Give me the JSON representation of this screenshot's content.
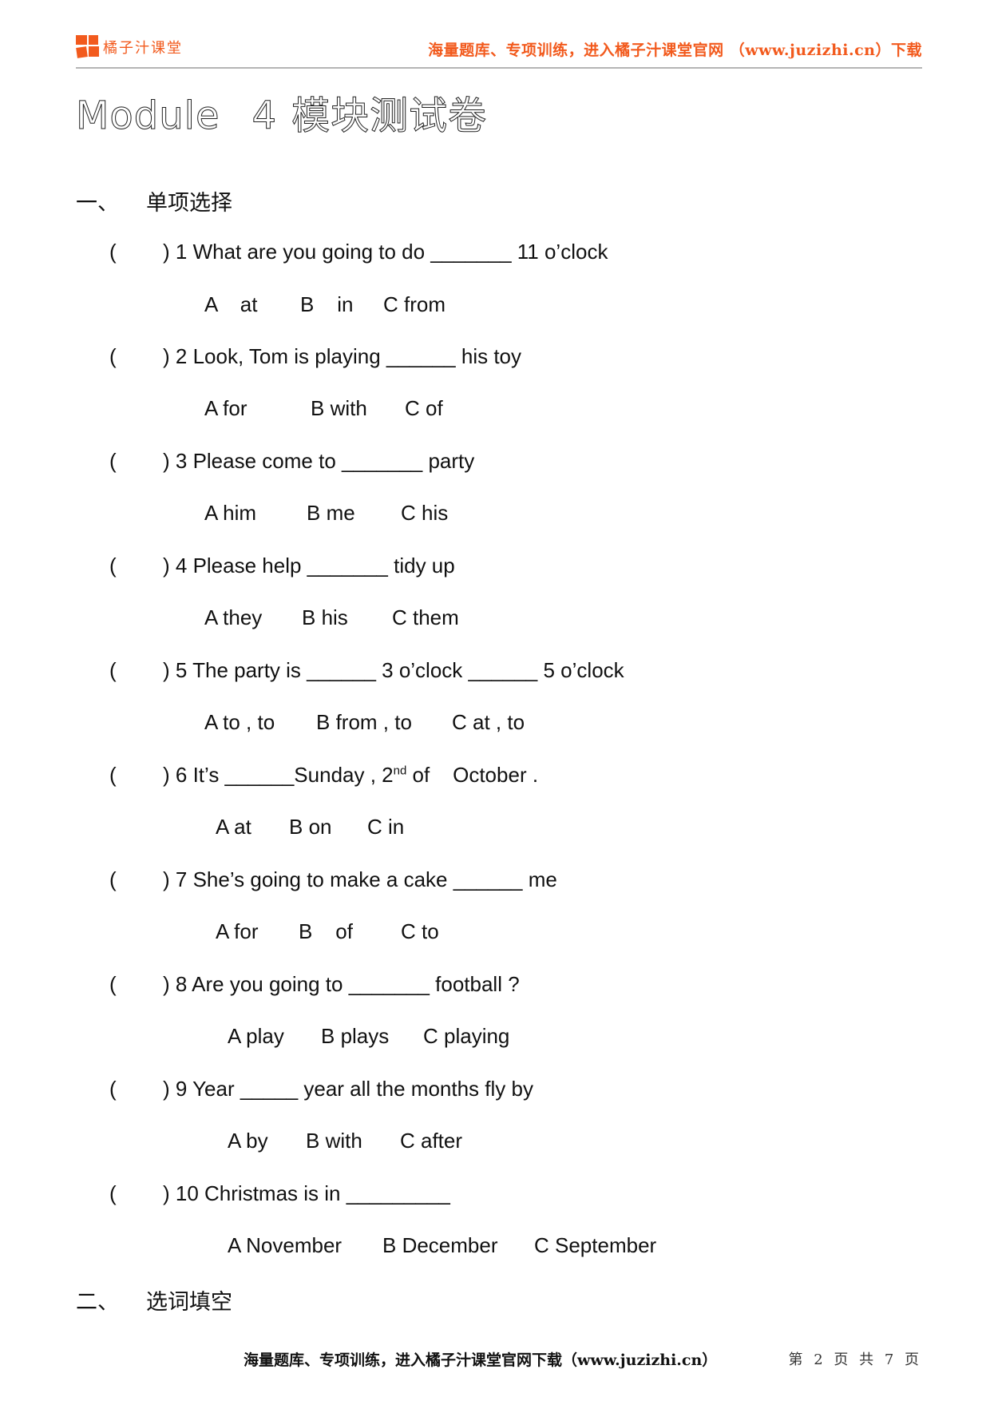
{
  "header": {
    "brand": "橘子汁课堂",
    "slogan": "海量题库、专项训练，进入橘子汁课堂官网 （www.juzizhi.cn）下载",
    "accent_color": "#f25a1d",
    "logo_icon": "four-squares-logo-icon"
  },
  "title": {
    "module": "Module",
    "number": "4",
    "subtitle": "模块测试卷"
  },
  "sections": [
    {
      "index": "一、",
      "title": "单项选择"
    },
    {
      "index": "二、",
      "title": "选词填空"
    }
  ],
  "questions": [
    {
      "open": "(",
      "text": ") 1 What are you going to do _______ 11 o’clock",
      "options": [
        "A    at",
        "B    in",
        "C from"
      ]
    },
    {
      "open": "(",
      "text": ") 2 Look, Tom is playing ______ his toy",
      "options": [
        "A for",
        "B with",
        "C of"
      ]
    },
    {
      "open": "(",
      "text": ") 3 Please come to _______ party",
      "options": [
        "A him",
        "B me",
        "C his"
      ]
    },
    {
      "open": "(",
      "text": ") 4 Please help _______ tidy up",
      "options": [
        "A they",
        "B his",
        "C them"
      ]
    },
    {
      "open": "(",
      "text": ") 5 The party is ______ 3 o’clock ______ 5 o’clock",
      "options": [
        "A to , to",
        "B from , to",
        "C at , to"
      ]
    },
    {
      "open": "(",
      "text_before": ") 6 It’s ______Sunday , 2",
      "sup": "nd",
      "text_after": " of    October .",
      "options": [
        "A at",
        "B on",
        "C in"
      ]
    },
    {
      "open": "(",
      "text": ") 7 She’s going to make a cake ______ me",
      "options": [
        "A for",
        "B    of",
        "C to"
      ]
    },
    {
      "open": "(",
      "text": ") 8 Are you going to _______ football ?",
      "options": [
        "A play",
        "B plays",
        "C playing"
      ]
    },
    {
      "open": "(",
      "text": ") 9 Year _____ year all the months fly by",
      "options": [
        "A by",
        "B with",
        "C after"
      ]
    },
    {
      "open": "(",
      "text": ") 10 Christmas is in _________",
      "options": [
        "A November",
        "B December",
        "C September"
      ]
    }
  ],
  "footer": {
    "text": "海量题库、专项训练，进入橘子汁课堂官网下载（www.juzizhi.cn）",
    "page": "第 2 页 共 7 页"
  }
}
